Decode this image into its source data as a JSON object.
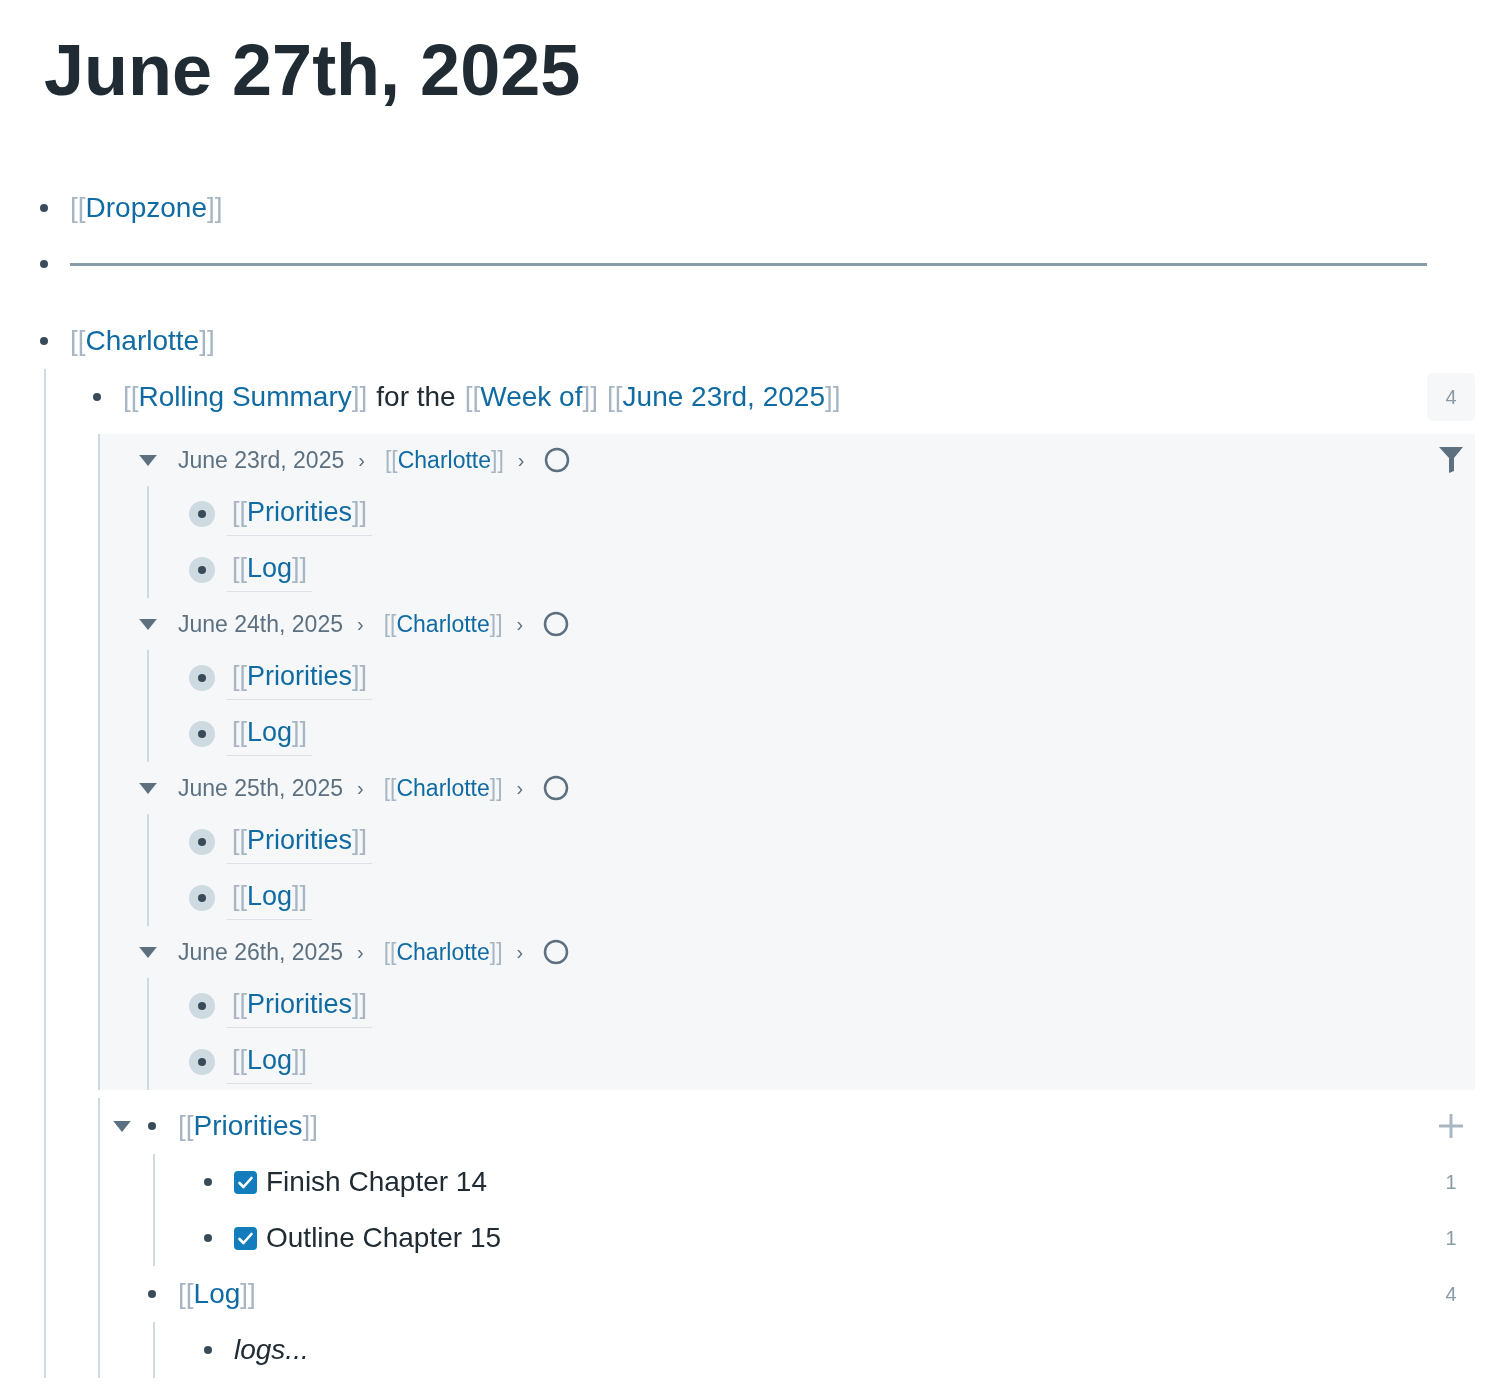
{
  "page_title": "June 27th, 2025",
  "blocks": [
    {
      "kind": "ref",
      "link": {
        "open": "[[",
        "title": "Dropzone",
        "close": "]]"
      }
    },
    {
      "kind": "divider"
    },
    {
      "kind": "ref",
      "link": {
        "open": "[[",
        "title": "Charlotte",
        "close": "]]"
      },
      "children": [
        {
          "kind": "summary",
          "segments": [
            {
              "kind": "ref",
              "link": {
                "open": "[[",
                "title": "Rolling Summary",
                "close": "]]"
              }
            },
            {
              "kind": "text",
              "text": "for the"
            },
            {
              "kind": "ref",
              "link": {
                "open": "[[",
                "title": "Week of",
                "close": "]]"
              }
            },
            {
              "kind": "ref",
              "link": {
                "open": "[[",
                "title": "June 23rd, 2025",
                "close": "]]"
              }
            }
          ],
          "ref_count": "4",
          "linked_results": [
            {
              "expanded": true,
              "breadcrumb": [
                {
                  "kind": "date",
                  "text": "June 23rd, 2025"
                },
                {
                  "kind": "sep",
                  "text": "›"
                },
                {
                  "kind": "ref",
                  "link": {
                    "open": "[[",
                    "title": "Charlotte",
                    "close": "]]"
                  }
                },
                {
                  "kind": "sep",
                  "text": "›"
                }
              ],
              "items": [
                {
                  "open": "[[",
                  "title": "Priorities",
                  "close": "]]"
                },
                {
                  "open": "[[",
                  "title": "Log",
                  "close": "]]"
                }
              ]
            },
            {
              "expanded": true,
              "breadcrumb": [
                {
                  "kind": "date",
                  "text": "June 24th, 2025"
                },
                {
                  "kind": "sep",
                  "text": "›"
                },
                {
                  "kind": "ref",
                  "link": {
                    "open": "[[",
                    "title": "Charlotte",
                    "close": "]]"
                  }
                },
                {
                  "kind": "sep",
                  "text": "›"
                }
              ],
              "items": [
                {
                  "open": "[[",
                  "title": "Priorities",
                  "close": "]]"
                },
                {
                  "open": "[[",
                  "title": "Log",
                  "close": "]]"
                }
              ]
            },
            {
              "expanded": true,
              "breadcrumb": [
                {
                  "kind": "date",
                  "text": "June 25th, 2025"
                },
                {
                  "kind": "sep",
                  "text": "›"
                },
                {
                  "kind": "ref",
                  "link": {
                    "open": "[[",
                    "title": "Charlotte",
                    "close": "]]"
                  }
                },
                {
                  "kind": "sep",
                  "text": "›"
                }
              ],
              "items": [
                {
                  "open": "[[",
                  "title": "Priorities",
                  "close": "]]"
                },
                {
                  "open": "[[",
                  "title": "Log",
                  "close": "]]"
                }
              ]
            },
            {
              "expanded": true,
              "breadcrumb": [
                {
                  "kind": "date",
                  "text": "June 26th, 2025"
                },
                {
                  "kind": "sep",
                  "text": "›"
                },
                {
                  "kind": "ref",
                  "link": {
                    "open": "[[",
                    "title": "Charlotte",
                    "close": "]]"
                  }
                },
                {
                  "kind": "sep",
                  "text": "›"
                }
              ],
              "items": [
                {
                  "open": "[[",
                  "title": "Priorities",
                  "close": "]]"
                },
                {
                  "open": "[[",
                  "title": "Log",
                  "close": "]]"
                }
              ]
            }
          ],
          "children": [
            {
              "kind": "ref",
              "link": {
                "open": "[[",
                "title": "Priorities",
                "close": "]]"
              },
              "hovered": true,
              "expanded": true,
              "children": [
                {
                  "kind": "todo",
                  "text": "Finish Chapter 14",
                  "checked": true,
                  "ref_count": "1"
                },
                {
                  "kind": "todo",
                  "text": "Outline Chapter 15",
                  "checked": true,
                  "ref_count": "1"
                }
              ]
            },
            {
              "kind": "ref",
              "link": {
                "open": "[[",
                "title": "Log",
                "close": "]]"
              },
              "hovered": false,
              "ref_count": "4",
              "children": [
                {
                  "kind": "italic",
                  "text": "logs..."
                }
              ]
            }
          ]
        }
      ]
    }
  ]
}
